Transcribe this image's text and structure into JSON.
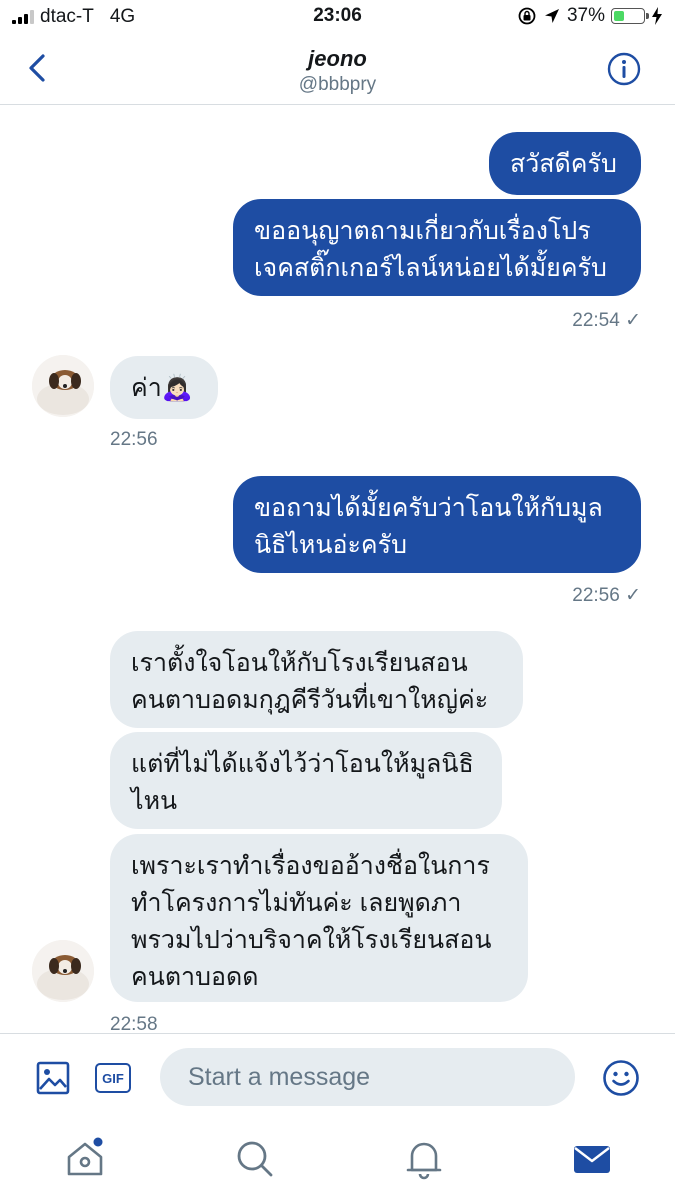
{
  "status_bar": {
    "carrier": "dtac-T",
    "network": "4G",
    "time": "23:06",
    "battery": "37%",
    "battery_level": 0.37
  },
  "header": {
    "name": "jeono",
    "handle": "@bbbpry"
  },
  "messages": [
    {
      "direction": "sent",
      "lines": [
        "สวัสดีครับ"
      ]
    },
    {
      "direction": "sent",
      "lines": [
        "ขออนุญาตถามเกี่ยวกับเรื่องโปร",
        "เจคสติ๊กเกอร์ไลน์หน่อยได้มั้ยครับ"
      ],
      "time": "22:54 ✓"
    },
    {
      "direction": "received",
      "lines": [
        "ค่า🙇🏻‍♀️"
      ],
      "time": "22:56"
    },
    {
      "direction": "sent",
      "lines": [
        "ขอถามได้มั้ยครับว่าโอนให้กับมูล",
        "นิธิไหนอ่ะครับ"
      ],
      "time": "22:56 ✓"
    },
    {
      "direction": "received",
      "lines": [
        "เราตั้งใจโอนให้กับโรงเรียนสอน",
        "คนตาบอดมกุฎคีรีวันที่เขาใหญ่ค่ะ"
      ]
    },
    {
      "direction": "received",
      "lines": [
        "แต่ที่ไม่ได้แจ้งไว้ว่าโอนให้มูลนิธิ",
        "ไหน"
      ]
    },
    {
      "direction": "received",
      "lines": [
        "เพราะเราทำเรื่องขออ้างชื่อในการ",
        "ทำโครงการไม่ทันค่ะ เลยพูดภา",
        "พรวมไปว่าบริจาคให้โรงเรียนสอน",
        "คนตาบอดด"
      ],
      "time": "22:58"
    }
  ],
  "composer": {
    "placeholder": "Start a message",
    "gif_label": "GIF"
  },
  "colors": {
    "accent": "#1e4da3",
    "bubble_in": "#e6ecf0",
    "meta": "#657786"
  },
  "icons": [
    "back-icon",
    "info-icon",
    "image-icon",
    "gif-icon",
    "emoji-icon",
    "home-icon",
    "search-icon",
    "notifications-icon",
    "messages-icon"
  ]
}
